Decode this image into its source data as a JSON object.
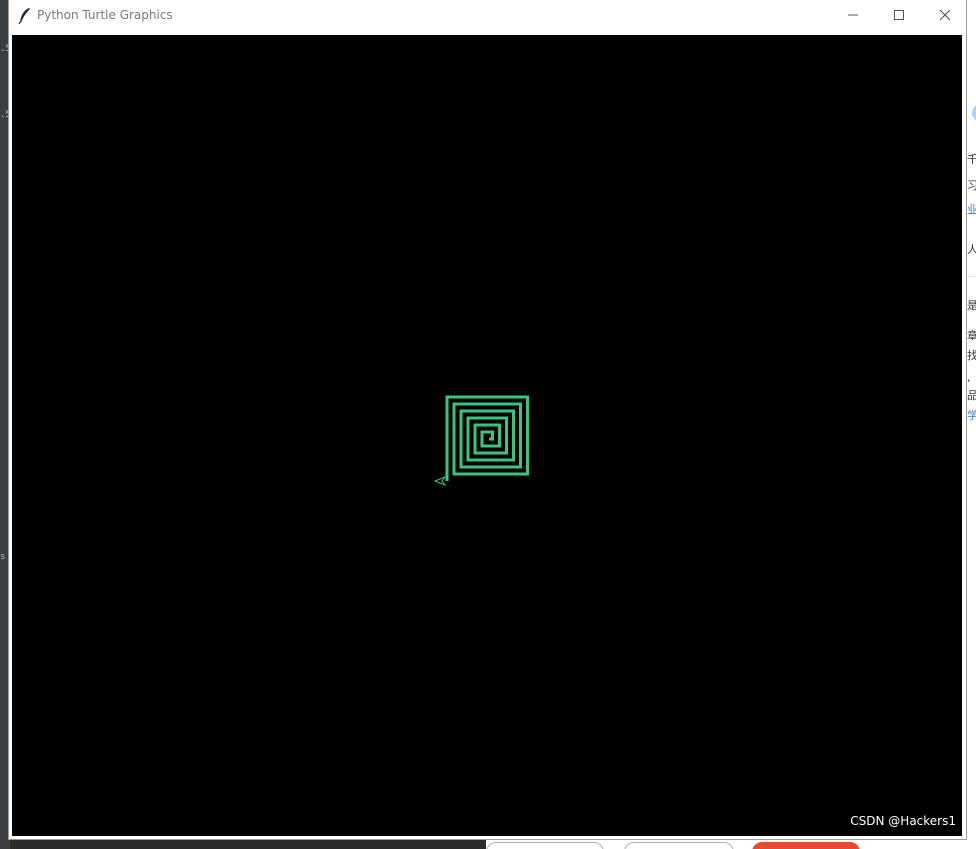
{
  "window": {
    "title": "Python Turtle Graphics",
    "controls": {
      "minimize_icon": "minimize-icon",
      "maximize_icon": "maximize-icon",
      "close_icon": "close-icon"
    }
  },
  "canvas": {
    "background_color": "#000000",
    "pen_color": "#3cc47c",
    "turtle_icon": "turtle-arrow-icon",
    "drawing": "square spiral"
  },
  "watermark": "CSDN @Hackers1"
}
